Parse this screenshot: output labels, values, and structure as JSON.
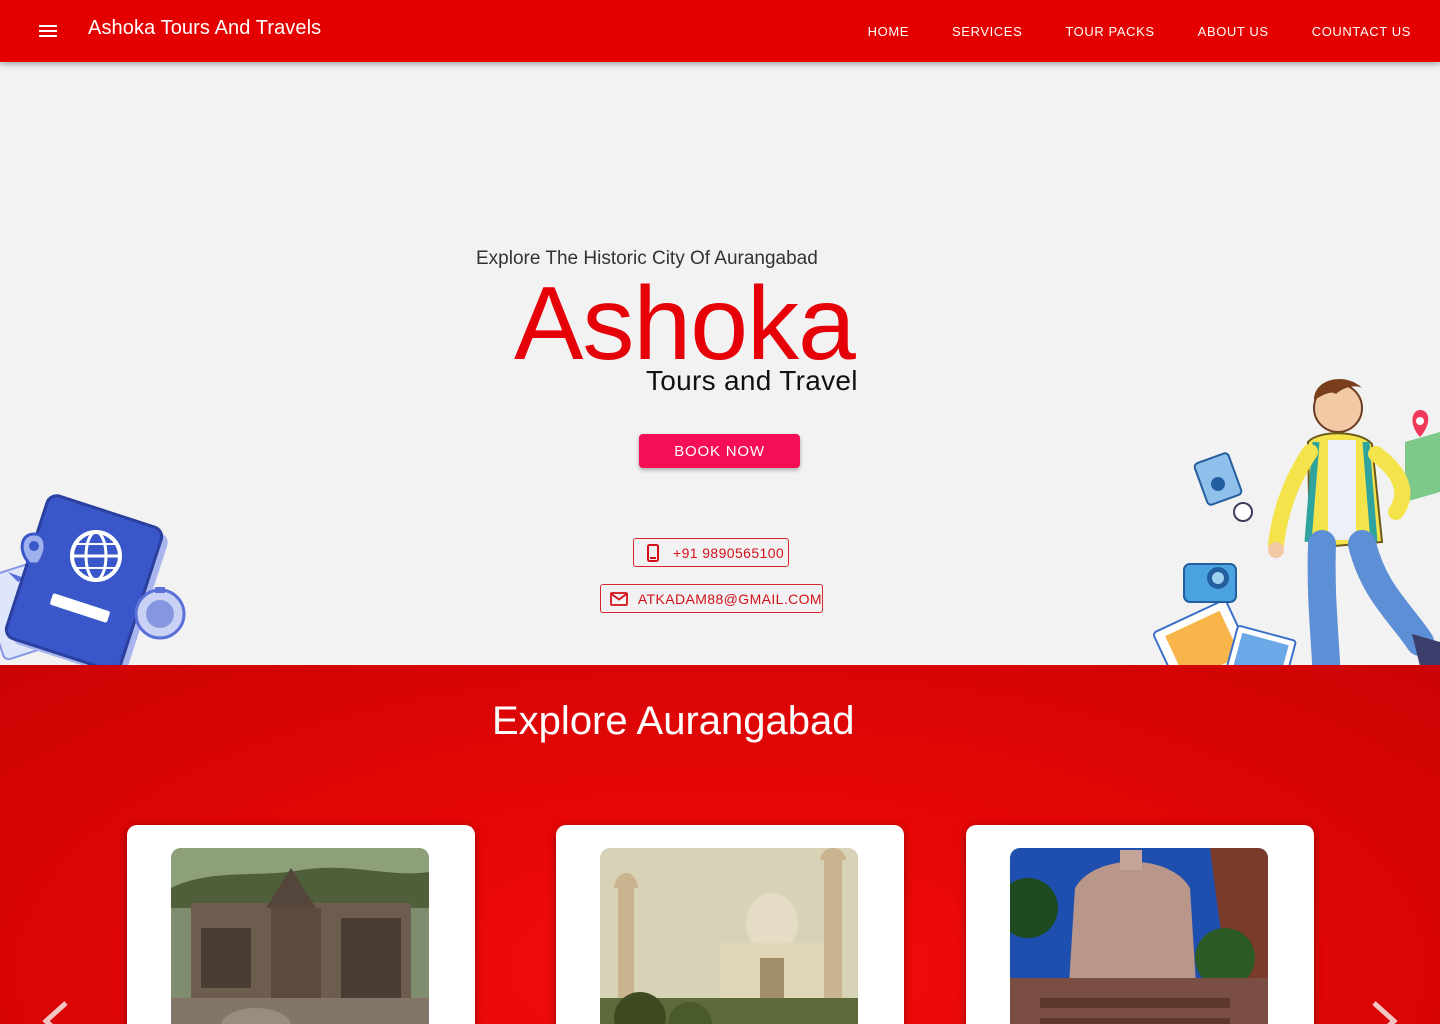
{
  "header": {
    "brand": "Ashoka Tours And Travels",
    "menu_icon": "hamburger-menu-icon",
    "nav": [
      {
        "label": "HOME"
      },
      {
        "label": "SERVICES"
      },
      {
        "label": "TOUR PACKS"
      },
      {
        "label": "ABOUT US"
      },
      {
        "label": "COUNTACT US"
      }
    ]
  },
  "hero": {
    "tagline": "Explore The Historic City Of Aurangabad",
    "title": "Ashoka",
    "subtitle": "Tours and Travel",
    "book_button": "BOOK NOW",
    "phone": "+91 9890565100",
    "email": "ATKADAM88@GMAIL.COM"
  },
  "explore": {
    "title": "Explore Aurangabad",
    "cards": [
      {
        "image": "ellora-caves-photo"
      },
      {
        "image": "bibi-ka-maqbara-photo"
      },
      {
        "image": "grishneshwar-temple-photo"
      }
    ]
  },
  "colors": {
    "primary": "#e50000",
    "accent": "#f50d55",
    "title_red": "#e60008",
    "background": "#f2f2f2"
  }
}
